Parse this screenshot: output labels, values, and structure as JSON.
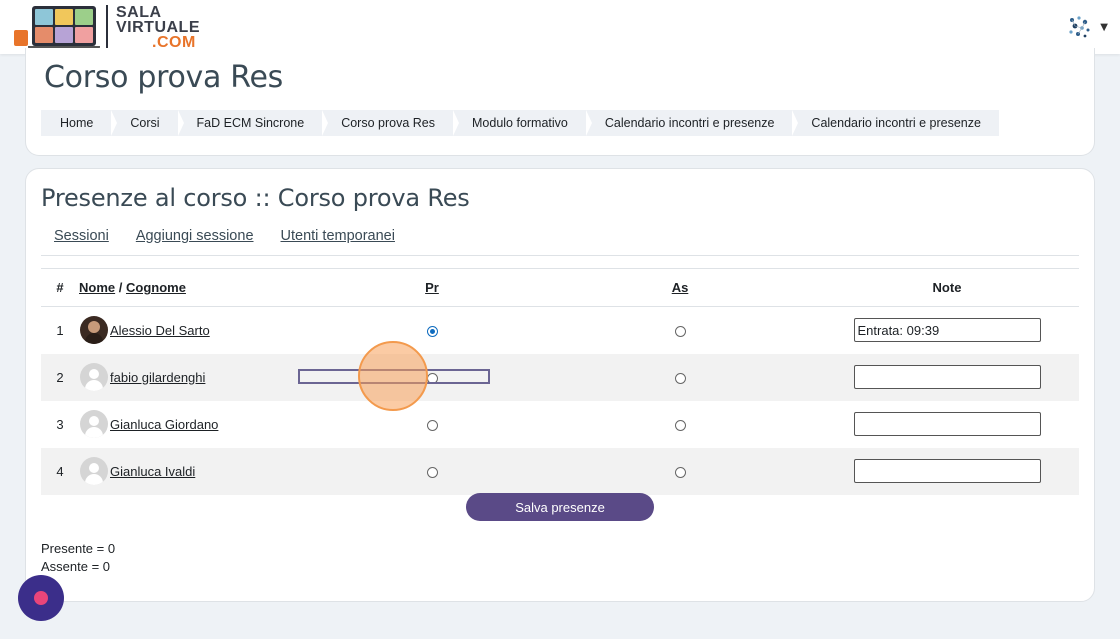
{
  "brand": {
    "line1": "SALA",
    "line2": "VIRTUALE",
    "line3": ".COM"
  },
  "header": {
    "title": "Corso prova Res",
    "breadcrumb": [
      "Home",
      "Corsi",
      "FaD ECM Sincrone",
      "Corso prova Res",
      "Modulo formativo",
      "Calendario incontri e presenze",
      "Calendario incontri e presenze"
    ]
  },
  "main": {
    "title": "Presenze al corso :: Corso prova Res",
    "tabs": [
      "Sessioni",
      "Aggiungi sessione",
      "Utenti temporanei"
    ],
    "table": {
      "col_num": "#",
      "col_nome": "Nome",
      "col_sep": "/",
      "col_cognome": "Cognome",
      "col_pr": "Pr",
      "col_as": "As",
      "col_note": "Note",
      "rows": [
        {
          "num": "1",
          "name": "Alessio Del Sarto",
          "pr": true,
          "as": false,
          "note": "Entrata: 09:39"
        },
        {
          "num": "2",
          "name": "fabio gilardenghi",
          "pr": false,
          "as": false,
          "note": ""
        },
        {
          "num": "3",
          "name": "Gianluca Giordano",
          "pr": false,
          "as": false,
          "note": ""
        },
        {
          "num": "4",
          "name": "Gianluca Ivaldi",
          "pr": false,
          "as": false,
          "note": ""
        }
      ]
    },
    "save_label": "Salva presenze",
    "summary_present": "Presente = 0",
    "summary_absent": "Assente = 0"
  },
  "colors": {
    "accent": "#5a4a87",
    "brand_orange": "#e8742a",
    "radio_checked": "#0f6cbf"
  },
  "icons": {
    "user_menu": "network-avatar-icon",
    "caret": "caret-down-icon",
    "record": "record-icon"
  }
}
